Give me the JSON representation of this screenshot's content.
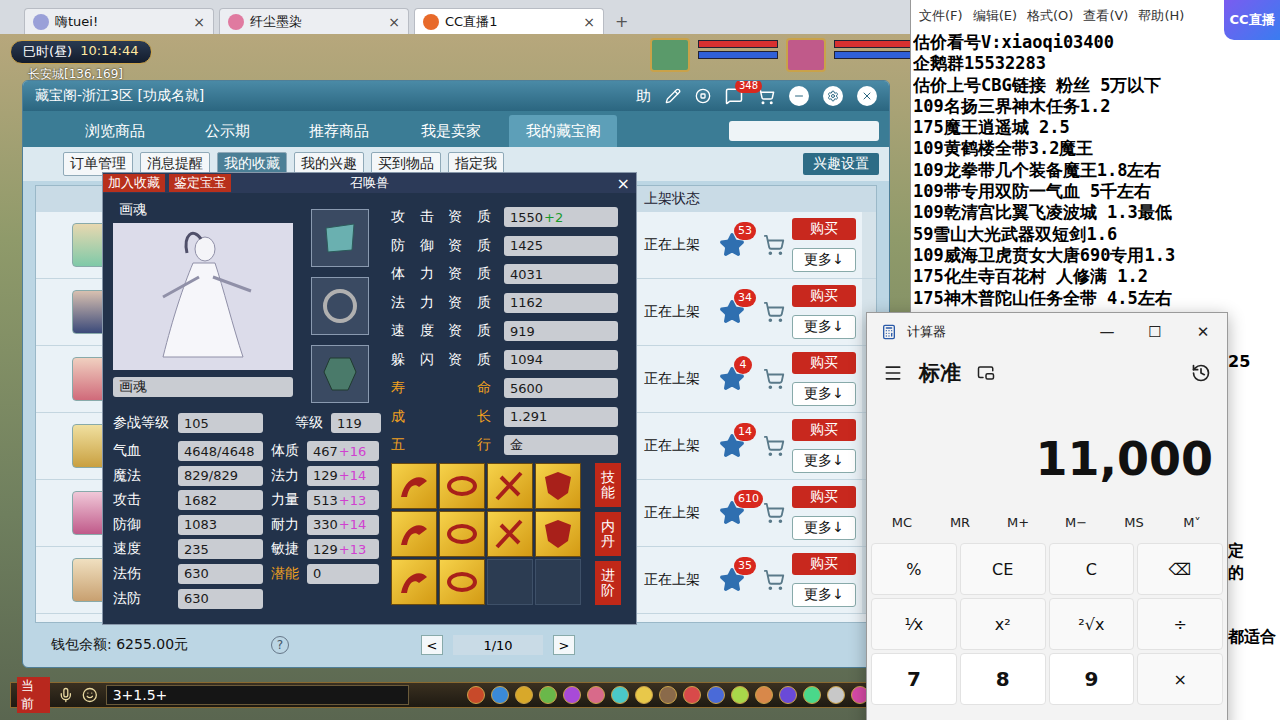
{
  "browser": {
    "tabs": [
      {
        "label": "嗨tuei!",
        "selected": false
      },
      {
        "label": "纤尘墨染",
        "selected": false
      },
      {
        "label": "CC直播1",
        "selected": true
      }
    ],
    "close": "×",
    "new_tab": "+"
  },
  "cc_logo": "CC直播",
  "game_hud": {
    "period": "巳时(昼)",
    "time": "10:14:44",
    "location": "长安城[136,169]"
  },
  "cbg": {
    "title": "藏宝阁-浙江3区 [功成名就]",
    "help": "助",
    "chat_badge": "348",
    "tabs": [
      {
        "label": "浏览商品",
        "selected": false
      },
      {
        "label": "公示期",
        "selected": false
      },
      {
        "label": "推荐商品",
        "selected": false
      },
      {
        "label": "我是卖家",
        "selected": false
      },
      {
        "label": "我的藏宝阁",
        "selected": true
      }
    ],
    "subtabs": [
      {
        "label": "订单管理",
        "selected": false
      },
      {
        "label": "消息提醒",
        "selected": false
      },
      {
        "label": "我的收藏",
        "selected": true
      },
      {
        "label": "我的兴趣",
        "selected": false
      },
      {
        "label": "买到物品",
        "selected": false
      },
      {
        "label": "指定我",
        "selected": false
      }
    ],
    "interest_button": "兴趣设置",
    "column_header": "上架状态",
    "rows": [
      {
        "status": "正在上架",
        "favorites": "53",
        "buy": "购买",
        "more": "更多↓"
      },
      {
        "status": "正在上架",
        "favorites": "34",
        "buy": "购买",
        "more": "更多↓"
      },
      {
        "status": "正在上架",
        "favorites": "4",
        "buy": "购买",
        "more": "更多↓"
      },
      {
        "status": "正在上架",
        "favorites": "14",
        "buy": "购买",
        "more": "更多↓"
      },
      {
        "status": "正在上架",
        "favorites": "610",
        "buy": "购买",
        "more": "更多↓"
      },
      {
        "status": "正在上架",
        "favorites": "35",
        "buy": "购买",
        "more": "更多↓"
      }
    ],
    "wallet": "钱包余额: 6255.00元",
    "help_icon": "?",
    "pager": {
      "prev": "<",
      "page": "1/10",
      "next": ">"
    }
  },
  "pet": {
    "header_buttons": [
      "加入收藏",
      "鉴定宝宝"
    ],
    "title": "召唤兽",
    "close": "×",
    "name": "画魂",
    "name_field": "画魂",
    "battle_level": {
      "label": "参战等级",
      "value": "105"
    },
    "level": {
      "label": "等级",
      "value": "119"
    },
    "stats": [
      {
        "label": "气血",
        "value": "4648/4648"
      },
      {
        "label": "魔法",
        "value": "829/829"
      },
      {
        "label": "攻击",
        "value": "1682"
      },
      {
        "label": "防御",
        "value": "1083"
      },
      {
        "label": "速度",
        "value": "235"
      },
      {
        "label": "法伤",
        "value": "630"
      },
      {
        "label": "法防",
        "value": "630"
      }
    ],
    "attributes": [
      {
        "label": "体质",
        "value": "467",
        "bonus": "+16",
        "highlight": false
      },
      {
        "label": "法力",
        "value": "129",
        "bonus": "+14",
        "highlight": false
      },
      {
        "label": "力量",
        "value": "513",
        "bonus": "+13",
        "highlight": false
      },
      {
        "label": "耐力",
        "value": "330",
        "bonus": "+14",
        "highlight": false
      },
      {
        "label": "敏捷",
        "value": "129",
        "bonus": "+13",
        "highlight": false
      },
      {
        "label": "潜能",
        "value": "0",
        "bonus": "",
        "highlight": true
      }
    ],
    "qualities": [
      {
        "label": "攻击资质",
        "value": "1550",
        "bonus": "+2",
        "highlight": false
      },
      {
        "label": "防御资质",
        "value": "1425",
        "bonus": "",
        "highlight": false
      },
      {
        "label": "体力资质",
        "value": "4031",
        "bonus": "",
        "highlight": false
      },
      {
        "label": "法力资质",
        "value": "1162",
        "bonus": "",
        "highlight": false
      },
      {
        "label": "速度资质",
        "value": "919",
        "bonus": "",
        "highlight": false
      },
      {
        "label": "躲闪资质",
        "value": "1094",
        "bonus": "",
        "highlight": false
      },
      {
        "label": "寿命",
        "value": "5600",
        "bonus": "",
        "highlight": true
      },
      {
        "label": "成长",
        "value": "1.291",
        "bonus": "",
        "highlight": true
      },
      {
        "label": "五行",
        "value": "金",
        "bonus": "",
        "highlight": true
      }
    ],
    "skills": [
      {
        "filled": true
      },
      {
        "filled": true
      },
      {
        "filled": true
      },
      {
        "filled": true
      },
      {
        "filled": true
      },
      {
        "filled": true
      },
      {
        "filled": true
      },
      {
        "filled": true
      },
      {
        "filled": true
      },
      {
        "filled": true
      },
      {
        "filled": false
      },
      {
        "filled": false
      }
    ],
    "side_buttons": [
      "技能",
      "内丹",
      "进阶"
    ]
  },
  "chat": {
    "channel": "当前",
    "input": "3+1.5+"
  },
  "notepad": {
    "menu": [
      "文件(F)",
      "编辑(E)",
      "格式(O)",
      "查看(V)",
      "帮助(H)"
    ],
    "lines": [
      "估价看号V:xiaoqi03400",
      "企鹅群15532283",
      "估价上号CBG链接 粉丝 5万以下",
      "109名扬三界神木任务1.2",
      "175魔王逍遥城 2.5",
      "109黄鹤楼全带3.2魔王",
      "109龙拳带几个装备魔王1.8左右",
      "109带专用双防一气血 5千左右",
      "109乾清宫比翼飞凌波城 1.3最低",
      "59雪山大光武器双短剑1.6",
      "109威海卫虎贲女大唐690专用1.3",
      "175化生寺百花村 人修满 1.2",
      "175神木普陀山任务全带 4.5左右"
    ],
    "fragments": [
      "25",
      "定",
      "的",
      "都适合"
    ]
  },
  "calculator": {
    "title": "计算器",
    "controls": [
      "—",
      "☐",
      "✕"
    ],
    "mode": "标准",
    "display": "11,000",
    "memory": [
      "MC",
      "MR",
      "M+",
      "M−",
      "MS",
      "M˅"
    ],
    "keys": [
      {
        "label": "%",
        "kind": "op"
      },
      {
        "label": "CE",
        "kind": "op"
      },
      {
        "label": "C",
        "kind": "op"
      },
      {
        "label": "⌫",
        "kind": "op"
      },
      {
        "label": "⅟x",
        "kind": "op"
      },
      {
        "label": "x²",
        "kind": "op"
      },
      {
        "label": "²√x",
        "kind": "op"
      },
      {
        "label": "÷",
        "kind": "op"
      },
      {
        "label": "7",
        "kind": "digit"
      },
      {
        "label": "8",
        "kind": "digit"
      },
      {
        "label": "9",
        "kind": "digit"
      },
      {
        "label": "×",
        "kind": "op"
      }
    ]
  }
}
